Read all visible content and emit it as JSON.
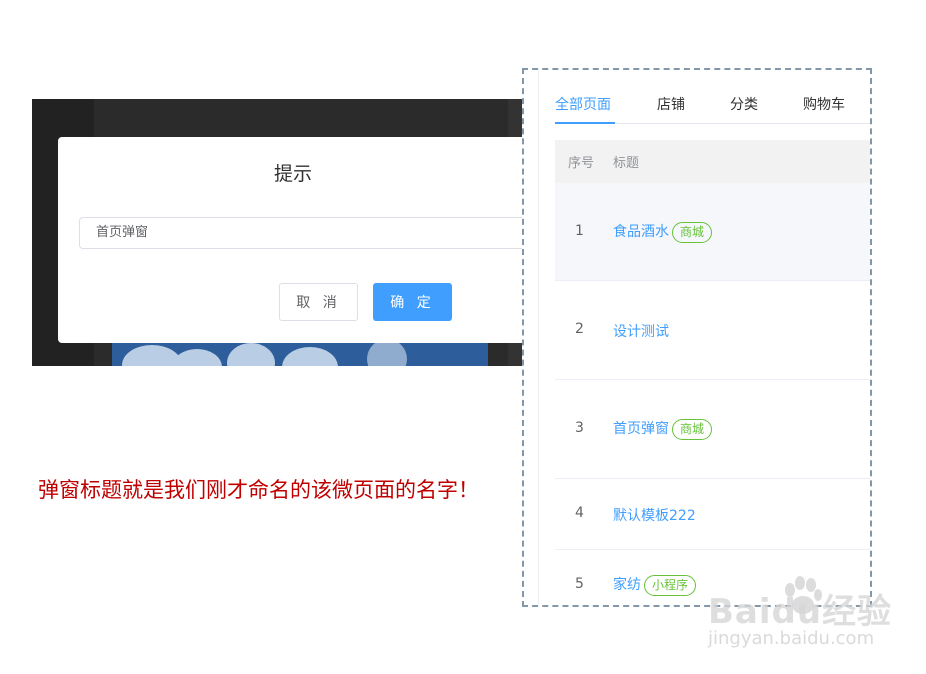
{
  "dialog": {
    "title": "提示",
    "input_value": "首页弹窗",
    "cancel_label": "取 消",
    "confirm_label": "确 定"
  },
  "caption": "弹窗标题就是我们刚才命名的该微页面的名字！",
  "panel": {
    "tabs": [
      {
        "label": "全部页面",
        "active": true
      },
      {
        "label": "店铺"
      },
      {
        "label": "分类"
      },
      {
        "label": "购物车"
      }
    ],
    "columns": {
      "index": "序号",
      "title": "标题"
    },
    "rows": [
      {
        "index": "1",
        "title": "食品酒水",
        "tag": "商城"
      },
      {
        "index": "2",
        "title": "设计测试",
        "tag": ""
      },
      {
        "index": "3",
        "title": "首页弹窗",
        "tag": "商城"
      },
      {
        "index": "4",
        "title": "默认模板222",
        "tag": ""
      },
      {
        "index": "5",
        "title": "家纺",
        "tag": "小程序"
      }
    ]
  },
  "watermark": {
    "brand": "Baidu经验",
    "url": "jingyan.baidu.com"
  },
  "colors": {
    "accent": "#409eff",
    "tag_green": "#67c23a",
    "caption_red": "#c00000"
  }
}
